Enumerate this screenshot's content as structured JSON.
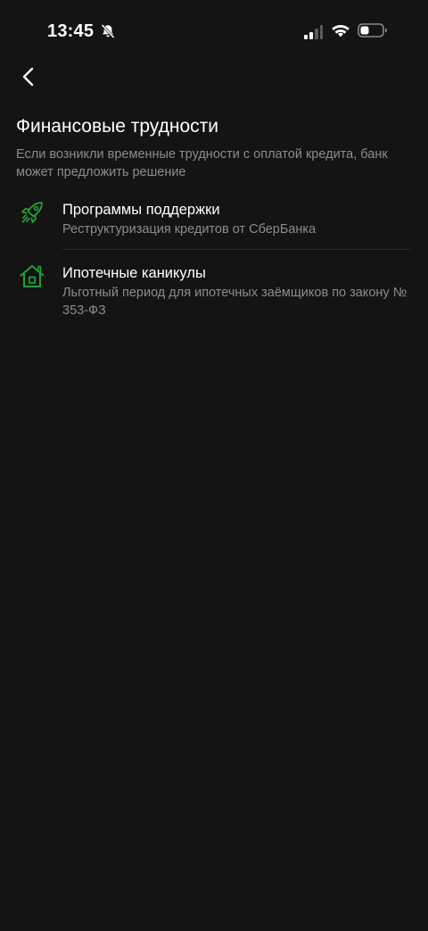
{
  "status_bar": {
    "time": "13:45",
    "icons": [
      "bell-off-icon",
      "cellular-signal-icon",
      "wifi-icon",
      "battery-icon"
    ]
  },
  "header": {
    "back_icon": "chevron-left-icon",
    "title": "Финансовые трудности",
    "subtitle": "Если возникли временные трудности с оплатой кредита, банк может предложить решение"
  },
  "items": [
    {
      "icon": "rocket-icon",
      "title": "Программы поддержки",
      "description": "Реструктуризация кредитов от СберБанка"
    },
    {
      "icon": "house-icon",
      "title": "Ипотечные каникулы",
      "description": "Льготный период для ипотечных заёмщиков по закону № 353-ФЗ"
    }
  ],
  "colors": {
    "background": "#141414",
    "accent": "#21a038",
    "text_primary": "#ffffff",
    "text_secondary": "#8c8c8c",
    "divider": "#2a2a2a"
  }
}
